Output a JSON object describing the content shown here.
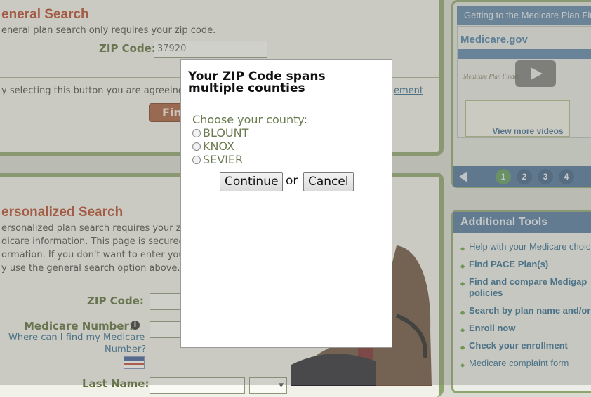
{
  "general": {
    "title": "eneral Search",
    "desc": "eneral plan search only requires your zip code.",
    "zip_label": "ZIP Code:",
    "zip_value": "37920",
    "agree_text": "y selecting this button you are agreeing",
    "agreement_link": "ement",
    "find_label": "Find"
  },
  "personal": {
    "title": "ersonalized Search",
    "lines": [
      "ersonalized plan search requires your z",
      "dicare information. This page is secured",
      "ormation. If you don't want to enter you",
      "y use the general search option above."
    ],
    "zip_label": "ZIP Code:",
    "medicare_label": "Medicare Number:",
    "info_icon": "info-icon",
    "where_link_1": "Where can I find my Medicare",
    "where_link_2": "Number?",
    "last_name_label": "Last Name:"
  },
  "video": {
    "header": "Getting to the Medicare Plan Find",
    "logo": "Medicare.gov",
    "thumb_heading": "Medicare Plan Finder",
    "more_videos": "View more videos",
    "pages": [
      "1",
      "2",
      "3",
      "4"
    ],
    "active_page": "1"
  },
  "tools": {
    "header": "Additional Tools",
    "items": [
      {
        "label": "Help with your Medicare choic",
        "bold": false
      },
      {
        "label": "Find PACE Plan(s)",
        "bold": true
      },
      {
        "label": "Find and compare Medigap",
        "bold": true
      },
      {
        "label": "policies",
        "bold": true
      },
      {
        "label": "Search by plan name and/or",
        "bold": true
      },
      {
        "label": "Enroll now",
        "bold": true
      },
      {
        "label": "Check your enrollment",
        "bold": true
      },
      {
        "label": "Medicare complaint form",
        "bold": false
      }
    ]
  },
  "modal": {
    "title": "Your ZIP Code spans multiple counties",
    "prompt": "Choose your county:",
    "options": [
      "BLOUNT",
      "KNOX",
      "SEVIER"
    ],
    "continue_label": "Continue",
    "or_label": "or",
    "cancel_label": "Cancel"
  },
  "colors": {
    "accent_green": "#8fa56e",
    "title_red": "#b5492b",
    "link_blue": "#2f6a8e",
    "header_blue": "#52799e"
  }
}
